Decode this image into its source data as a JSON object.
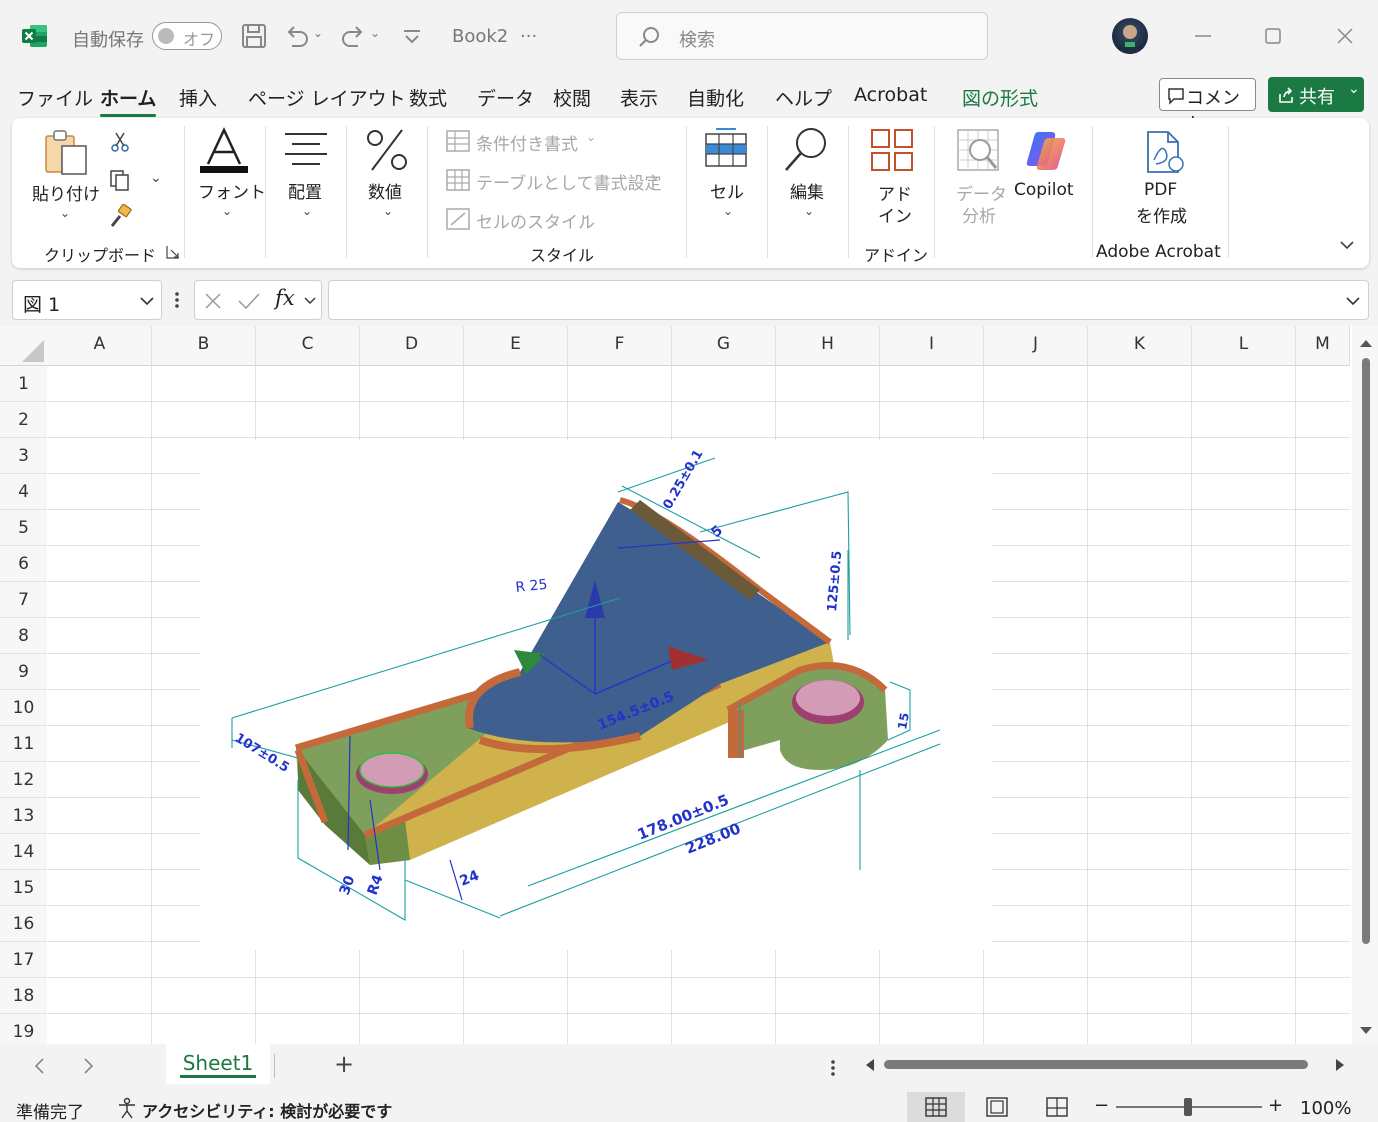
{
  "titlebar": {
    "autosave_label": "自動保存",
    "autosave_state": "オフ",
    "filename": "Book2",
    "filename_more": "···",
    "search_placeholder": "検索"
  },
  "menu": {
    "tabs": [
      "ファイル",
      "ホーム",
      "挿入",
      "ページ レイアウト",
      "数式",
      "データ",
      "校閲",
      "表示",
      "自動化",
      "ヘルプ",
      "Acrobat",
      "図の形式"
    ],
    "active": "ホーム",
    "comment_label": "コメント",
    "share_label": "共有"
  },
  "ribbon": {
    "paste": "貼り付け",
    "clipboard_group": "クリップボード",
    "font": "フォント",
    "alignment": "配置",
    "number": "数値",
    "cond_format": "条件付き書式",
    "table_format": "テーブルとして書式設定",
    "cell_styles": "セルのスタイル",
    "styles_group": "スタイル",
    "cells": "セル",
    "editing": "編集",
    "addin_line1": "アド",
    "addin_line2": "イン",
    "addins_group": "アドイン",
    "data_analysis_line1": "データ",
    "data_analysis_line2": "分析",
    "copilot": "Copilot",
    "pdf_line1": "PDF",
    "pdf_line2": "を作成",
    "acrobat_group": "Adobe Acrobat"
  },
  "formulabar": {
    "namebox": "図 1",
    "fx": "fx",
    "formula": ""
  },
  "grid": {
    "columns": [
      "A",
      "B",
      "C",
      "D",
      "E",
      "F",
      "G",
      "H",
      "I",
      "J",
      "K",
      "L",
      "M"
    ],
    "rows": [
      "1",
      "2",
      "3",
      "4",
      "5",
      "6",
      "7",
      "8",
      "9",
      "10",
      "11",
      "12",
      "13",
      "14",
      "15",
      "16",
      "17",
      "18",
      "19"
    ]
  },
  "drawing": {
    "dim_radius": "R 25",
    "dim_154": "154.5±0.5",
    "dim_178": "178.00±0.5",
    "dim_228": "228.00",
    "dim_24": "24",
    "dim_r4": "R4",
    "dim_30": "30",
    "dim_5": "5",
    "dim_angle": "0.25±0.1",
    "dim_height": "125±0.5",
    "dim_left": "107±0.5",
    "dim_right_h": "15"
  },
  "sheets": {
    "active": "Sheet1",
    "add": "+"
  },
  "status": {
    "ready": "準備完了",
    "accessibility": "アクセシビリティ: 検討が必要です",
    "zoom": "100%"
  },
  "colors": {
    "accent": "#1b7a43",
    "excel_green": "#107c41",
    "part_yellow": "#c9b24b",
    "part_olive": "#7d9e5a",
    "part_copper": "#c46a3a",
    "part_blue": "#3f5f8e",
    "dim_line": "#1aa0a0",
    "dim_text": "#2233cc"
  }
}
